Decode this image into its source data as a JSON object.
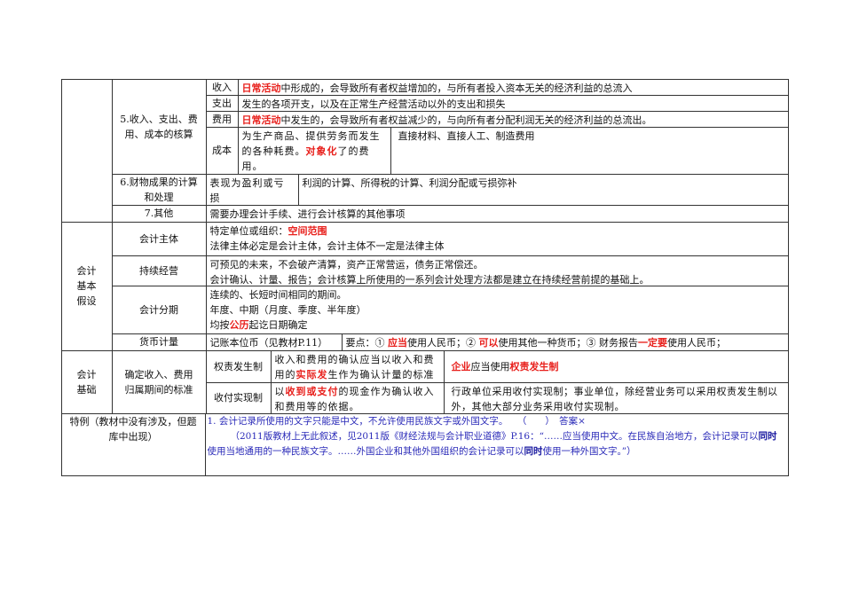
{
  "sec5": {
    "title": "5.收入、支出、费用、成本的核算",
    "income": {
      "label": "收入",
      "red": "日常活动",
      "rest": "中形成的，会导致所有者权益增加的，与所有者投入资本无关的经济利益的总流入"
    },
    "expenditure": {
      "label": "支出",
      "text": "发生的各项开支，以及在正常生产经营活动以外的支出和损失"
    },
    "expense": {
      "label": "费用",
      "red": "日常活动",
      "rest": "中发生的，会导致所有者权益减少的，与向所有者分配利润无关的经济利益的总流出。"
    },
    "cost": {
      "label": "成本",
      "pre": "为生产商品、提供劳务而发生的各种耗费。",
      "red": "对象化",
      "post": "了的费用。",
      "items": "直接材料、直接人工、制造费用"
    }
  },
  "sec6": {
    "title": "6.财物成果的计算和处理",
    "desc": "表现为盈利或亏损",
    "items": "利润的计算、所得税的计算、利润分配或亏损弥补"
  },
  "sec7": {
    "title": "7.其他",
    "text": "需要办理会计手续、进行会计核算的其他事项"
  },
  "assumptions": {
    "title": "会计基本假设",
    "entity": {
      "label": "会计主体",
      "l1": "特定单位或组织：",
      "l1red": "空间范围",
      "l2": "法律主体必定是会计主体，会计主体不一定是法律主体"
    },
    "going": {
      "label": "持续经营",
      "l1": "可预见的未来，不会破产清算，资产正常营运，债务正常偿还。",
      "l2": "会计确认、计量、报告；会计核算上所使用的一系列会计处理方法都是建立在持续经营前提的基础上。"
    },
    "period": {
      "label": "会计分期",
      "l1": "连续的、长短时间相同的期间。",
      "l2": "年度、中期（月度、季度、半年度）",
      "l3a": "均按",
      "l3red": "公历",
      "l3b": "起讫日期确定"
    },
    "money": {
      "label": "货币计量",
      "desc": "记账本位币（见教材P.11）",
      "p1": "要点：① ",
      "r1": "应当",
      "p2": "使用人民币；② ",
      "r2": "可以",
      "p3": "使用其他一种货币；③ 财务报告",
      "r3": "一定要",
      "p4": "使用人民币；"
    }
  },
  "basis": {
    "title": "会计基础",
    "sub": "确定收入、费用归属期间的标准",
    "accrual": {
      "label": "权责发生制",
      "a": "收入和费用的确认应当以收入和费用的",
      "red": "实际发",
      "b": "生作为确认计量的标准",
      "r1": "企业",
      "n1": "应当使用",
      "r2": "权责发生制"
    },
    "cash": {
      "label": "收付实现制",
      "a": "以",
      "red": "收到或支付",
      "b": "的现金作为确认收入和费用等的依据。",
      "note": "行政单位采用收付实现制；事业单位，除经营业务可以采用权责发生制以外，其他大部分业务采用收付实现制。"
    }
  },
  "special": {
    "title": "特例（教材中没有涉及，但题库中出现）",
    "q": "1. 会计记录所使用的文字只能是中文，不允许使用民族文字或外国文字。　　（　　）　答案×",
    "e1": "（2011版教材上无此叙述，见2011版《财经法规与会计职业道德》P.16：“……应当使用中文。在民族自治地方，会计记录可以",
    "e1b": "同时",
    "e2": "使用当地通用的一种民族文字。……外国企业和其他外国组织的会计记录可以",
    "e2b": "同时",
    "e3": "使用一种外国文字。”）"
  }
}
